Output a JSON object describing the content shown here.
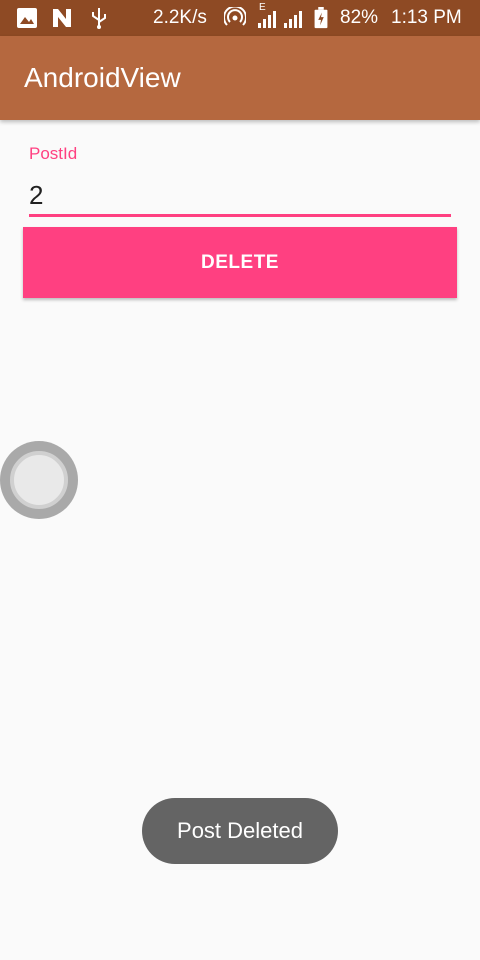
{
  "status_bar": {
    "speed": "2.2K/s",
    "network_label": "E",
    "battery": "82%",
    "time": "1:13 PM",
    "icons": [
      "image-icon",
      "n-icon",
      "usb-icon",
      "hotspot-icon",
      "signal-icon",
      "signal-icon",
      "battery-charging-icon"
    ]
  },
  "app_bar": {
    "title": "AndroidView"
  },
  "form": {
    "label": "PostId",
    "value": "2"
  },
  "delete_button": {
    "label": "DELETE"
  },
  "toast": {
    "message": "Post Deleted"
  },
  "colors": {
    "status_bar": "#8e4a24",
    "app_bar": "#b5683f",
    "accent": "#ff4081",
    "background": "#fafafa",
    "toast": "#646464"
  }
}
